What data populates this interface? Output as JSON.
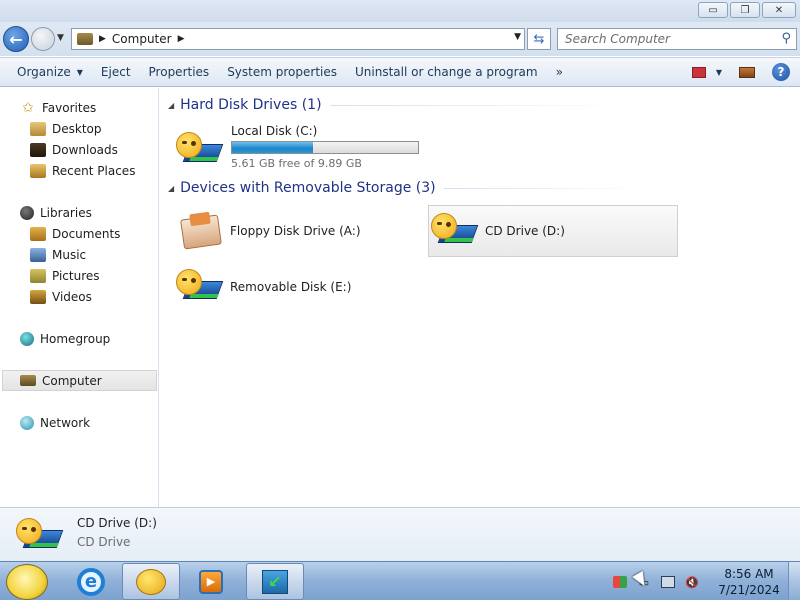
{
  "window": {
    "buttons": {
      "minimize": "▭",
      "maximize": "❐",
      "close": "✕"
    }
  },
  "address_bar": {
    "crumb": "Computer",
    "search_placeholder": "Search Computer"
  },
  "command_bar": {
    "organize": "Organize",
    "eject": "Eject",
    "properties": "Properties",
    "system_properties": "System properties",
    "uninstall": "Uninstall or change a program",
    "more": "»"
  },
  "nav_pane": {
    "favorites": "Favorites",
    "desktop": "Desktop",
    "downloads": "Downloads",
    "recent_places": "Recent Places",
    "libraries": "Libraries",
    "documents": "Documents",
    "music": "Music",
    "pictures": "Pictures",
    "videos": "Videos",
    "homegroup": "Homegroup",
    "computer": "Computer",
    "network": "Network"
  },
  "content": {
    "hdd_group": "Hard Disk Drives (1)",
    "removable_group": "Devices with Removable Storage (3)",
    "local_disk": {
      "name": "Local Disk (C:)",
      "free_text": "5.61 GB free of 9.89 GB",
      "used_fraction": 0.433
    },
    "floppy": "Floppy Disk Drive (A:)",
    "cd_drive": "CD Drive (D:)",
    "removable_disk": "Removable Disk (E:)"
  },
  "details_pane": {
    "name": "CD Drive (D:)",
    "type": "CD Drive"
  },
  "taskbar": {
    "time": "8:56 AM",
    "date": "7/21/2024"
  },
  "colors": {
    "accent": "#1e3287",
    "disk_fill": "#1c84c8",
    "command_text": "#1e395b"
  },
  "icons": [
    "computer-icon",
    "back-arrow-icon",
    "forward-arrow-icon",
    "refresh-icon",
    "search-icon",
    "help-icon",
    "drive-icon",
    "floppy-icon",
    "ie-icon",
    "libraries-icon",
    "media-player-icon",
    "volume-muted-icon"
  ]
}
